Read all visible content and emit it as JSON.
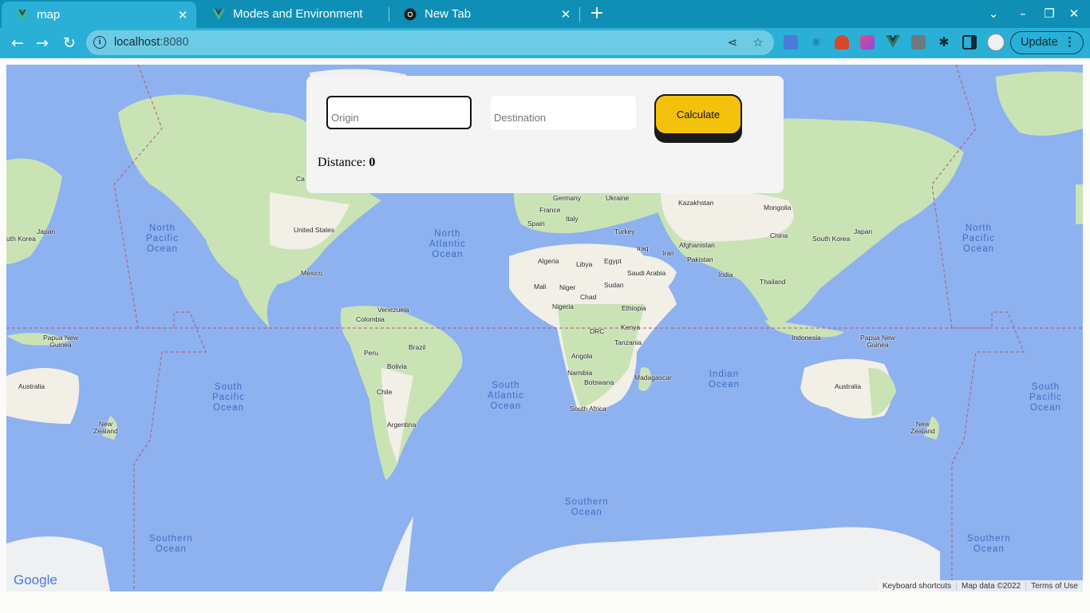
{
  "browser": {
    "tabs": [
      {
        "label": "map",
        "icon": "vue-icon",
        "active": true
      },
      {
        "label": "Modes and Environment",
        "icon": "vue-icon",
        "active": false
      },
      {
        "label": "New Tab",
        "icon": "chrome-icon",
        "active": false
      }
    ],
    "url_host": "localhost",
    "url_port": ":8080",
    "update_label": "Update",
    "colors": {
      "tabbar": "#0f8fb5",
      "toolbar": "#2ab0d6"
    }
  },
  "form": {
    "origin_placeholder": "Origin",
    "destination_placeholder": "Destination",
    "calculate_label": "Calculate",
    "distance_label": "Distance:",
    "distance_value": "0",
    "button_color": "#f4c20d"
  },
  "map": {
    "countries": {
      "canada": "Ca",
      "united_states": "United States",
      "mexico": "Mexico",
      "venezuela": "Venezuela",
      "colombia": "Colombia",
      "peru": "Peru",
      "brazil": "Brazil",
      "bolivia": "Bolivia",
      "chile": "Chile",
      "argentina": "Argentina",
      "germany": "Germany",
      "ukraine": "Ukraine",
      "france": "France",
      "spain": "Spain",
      "italy": "Italy",
      "turkey": "Turkey",
      "kazakhstan": "Kazakhstan",
      "mongolia": "Mongolia",
      "china": "China",
      "south_korea_east": "South Korea",
      "japan_east": "Japan",
      "south_korea_west": "uth Korea",
      "japan_west": "Japan",
      "algeria": "Algeria",
      "libya": "Libya",
      "egypt": "Egypt",
      "iraq": "Iraq",
      "iran": "Iran",
      "afghanistan": "Afghanistan",
      "pakistan": "Pakistan",
      "saudi_arabia": "Saudi Arabia",
      "india": "India",
      "thailand": "Thailand",
      "mali": "Mali",
      "niger": "Niger",
      "sudan": "Sudan",
      "chad": "Chad",
      "nigeria": "Nigeria",
      "ethiopia": "Ethiopia",
      "drc": "DRC",
      "kenya": "Kenya",
      "tanzania": "Tanzania",
      "angola": "Angola",
      "namibia": "Namibia",
      "botswana": "Botswana",
      "madagascar": "Madagascar",
      "south_africa": "South Africa",
      "indonesia": "Indonesia",
      "png_east": "Papua New\nGuinea",
      "png_west": "Papua New\nGuinea",
      "australia_east": "Australia",
      "australia_west": "Australia",
      "nz_east": "New\nZealand",
      "nz_west": "New\nZealand"
    },
    "oceans": {
      "north_pacific_west": "North\nPacific\nOcean",
      "north_pacific_east": "North\nPacific\nOcean",
      "north_atlantic": "North\nAtlantic\nOcean",
      "south_pacific_west": "South\nPacific\nOcean",
      "south_pacific_east": "South\nPacific\nOcean",
      "south_atlantic": "South\nAtlantic\nOcean",
      "indian": "Indian\nOcean",
      "southern_center": "Southern\nOcean",
      "southern_west": "Southern\nOcean",
      "southern_east": "Southern\nOcean"
    },
    "google_logo": "Google",
    "attribution": [
      "Keyboard shortcuts",
      "Map data ©2022",
      "Terms of Use"
    ],
    "colors": {
      "water": "#8eb1ef",
      "land": "#c9e3b5",
      "desert": "#f1efe6",
      "ice": "#eef0f1"
    }
  }
}
